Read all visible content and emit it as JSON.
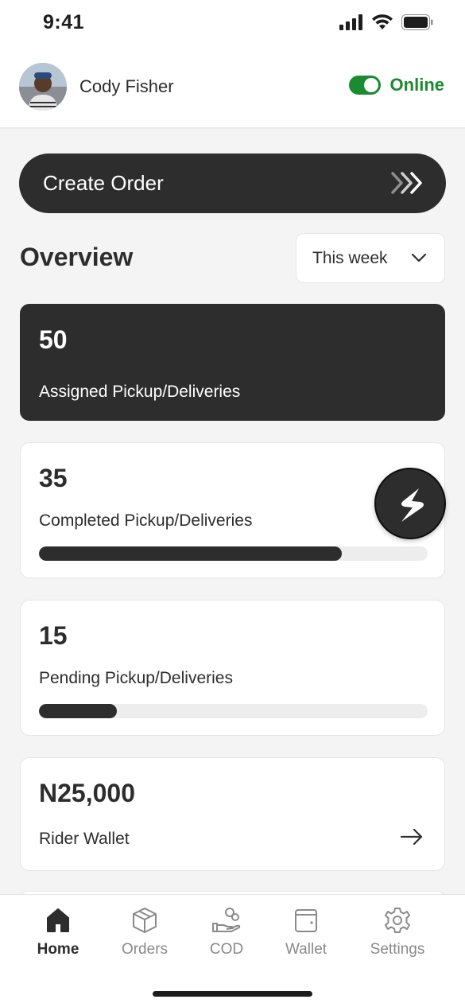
{
  "status_bar": {
    "time": "9:41"
  },
  "header": {
    "user_name": "Cody Fisher",
    "online_label": "Online",
    "online_enabled": true
  },
  "create_order": {
    "label": "Create Order"
  },
  "overview": {
    "title": "Overview",
    "period_selected": "This week"
  },
  "cards": {
    "assigned": {
      "value": "50",
      "label": "Assigned Pickup/Deliveries"
    },
    "completed": {
      "value": "35",
      "label": "Completed Pickup/Deliveries",
      "progress": 0.78
    },
    "pending": {
      "value": "15",
      "label": "Pending Pickup/Deliveries",
      "progress": 0.2
    },
    "wallet": {
      "value": "N25,000",
      "label": "Rider Wallet"
    }
  },
  "tabs": [
    {
      "label": "Home",
      "icon": "home-icon",
      "active": true
    },
    {
      "label": "Orders",
      "icon": "box-icon",
      "active": false
    },
    {
      "label": "COD",
      "icon": "cash-hand-icon",
      "active": false
    },
    {
      "label": "Wallet",
      "icon": "wallet-icon",
      "active": false
    },
    {
      "label": "Settings",
      "icon": "gear-icon",
      "active": false
    }
  ],
  "colors": {
    "accent_dark": "#2d2d2d",
    "online_green": "#1a8b2e",
    "background": "#f4f4f4"
  }
}
